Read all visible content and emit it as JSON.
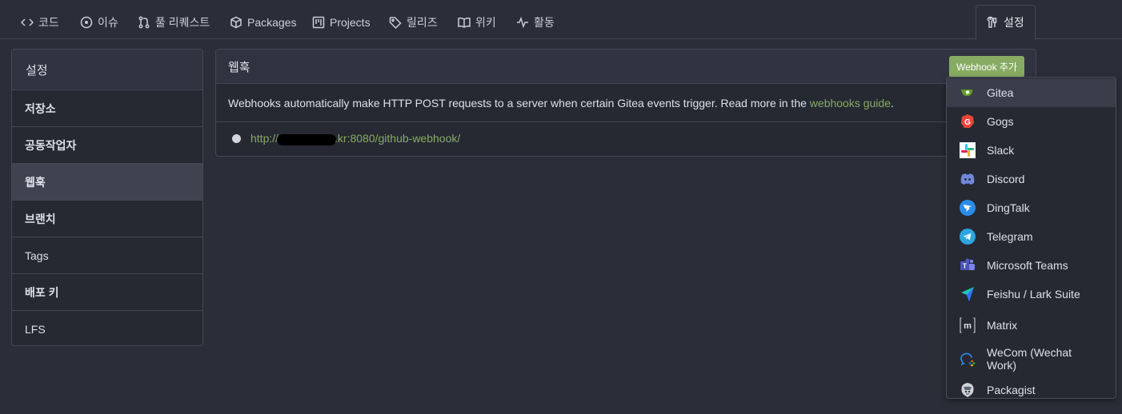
{
  "tabs": [
    {
      "label": "코드",
      "icon": "code-icon"
    },
    {
      "label": "이슈",
      "icon": "issue-icon"
    },
    {
      "label": "풀 리퀘스트",
      "icon": "pull-request-icon"
    },
    {
      "label": "Packages",
      "icon": "package-icon"
    },
    {
      "label": "Projects",
      "icon": "project-icon"
    },
    {
      "label": "릴리즈",
      "icon": "tag-icon"
    },
    {
      "label": "위키",
      "icon": "book-icon"
    },
    {
      "label": "활동",
      "icon": "pulse-icon"
    },
    {
      "label": "설정",
      "icon": "tools-icon",
      "active": true
    }
  ],
  "sidebar": {
    "title": "설정",
    "items": [
      {
        "label": "저장소"
      },
      {
        "label": "공동작업자"
      },
      {
        "label": "웹훅",
        "active": true
      },
      {
        "label": "브랜치"
      },
      {
        "label": "Tags"
      },
      {
        "label": "배포 키"
      },
      {
        "label": "LFS"
      }
    ]
  },
  "panel": {
    "title": "웹훅",
    "add_button": "Webhook 추가",
    "description_prefix": "Webhooks automatically make HTTP POST requests to a server when certain Gitea events trigger. Read more in the ",
    "description_link": "webhooks guide",
    "description_suffix": ".",
    "hook_url_start": "http://",
    "hook_url_end": ".kr:8080/github-webhook/"
  },
  "menu": {
    "items": [
      {
        "label": "Gitea",
        "icon": "gitea-icon"
      },
      {
        "label": "Gogs",
        "icon": "gogs-icon"
      },
      {
        "label": "Slack",
        "icon": "slack-icon"
      },
      {
        "label": "Discord",
        "icon": "discord-icon"
      },
      {
        "label": "DingTalk",
        "icon": "dingtalk-icon"
      },
      {
        "label": "Telegram",
        "icon": "telegram-icon"
      },
      {
        "label": "Microsoft Teams",
        "icon": "msteams-icon"
      },
      {
        "label": "Feishu / Lark Suite",
        "icon": "feishu-icon"
      },
      {
        "label": "Matrix",
        "icon": "matrix-icon"
      },
      {
        "label": "WeCom (Wechat Work)",
        "icon": "wecom-icon"
      },
      {
        "label": "Packagist",
        "icon": "packagist-icon"
      }
    ]
  },
  "colors": {
    "accent": "#87ab63",
    "background": "#2b2e38",
    "panel": "#262932",
    "border": "#434857"
  }
}
